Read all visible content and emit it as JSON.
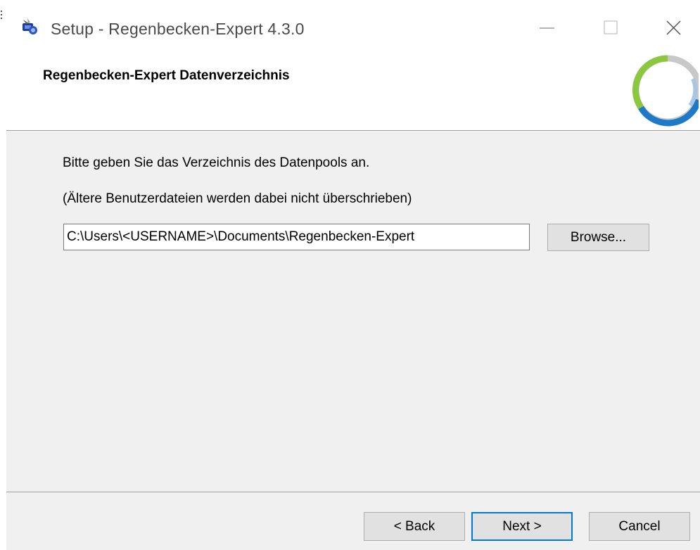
{
  "window": {
    "title": "Setup - Regenbecken-Expert 4.3.0"
  },
  "header": {
    "title": "Regenbecken-Expert Datenverzeichnis"
  },
  "content": {
    "prompt": "Bitte geben Sie das Verzeichnis des Datenpools an.",
    "hint": "(Ältere Benutzerdateien werden dabei nicht überschrieben)",
    "path_value": "C:\\Users\\<USERNAME>\\Documents\\Regenbecken-Expert",
    "browse_label": "Browse..."
  },
  "footer": {
    "back_label": "< Back",
    "next_label": "Next >",
    "cancel_label": "Cancel"
  },
  "icons": {
    "app": "setup-app-icon",
    "minimize": "minimize-icon",
    "maximize": "maximize-icon",
    "close": "close-icon",
    "logo": "ring-logo-icon"
  },
  "colors": {
    "logo_green": "#8dc63f",
    "logo_blue": "#1e7ac7",
    "logo_light_blue": "#a8c7e6",
    "logo_gray": "#c8c8c8",
    "focus_border": "#0078d7"
  }
}
